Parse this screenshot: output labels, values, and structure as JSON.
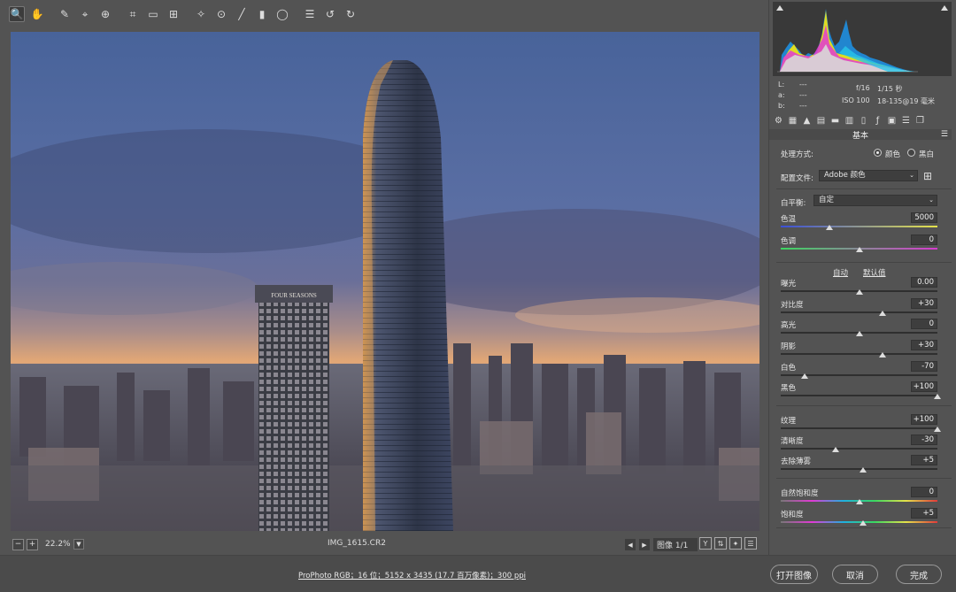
{
  "toolbar": {
    "tools": [
      {
        "name": "zoom-tool",
        "icon": "magnifier-icon",
        "glyph": "🔍",
        "active": true
      },
      {
        "name": "hand-tool",
        "icon": "hand-icon",
        "glyph": "✋"
      },
      {
        "name": "white-balance-tool",
        "icon": "eyedropper-icon",
        "glyph": "✎"
      },
      {
        "name": "color-sampler-tool",
        "icon": "color-sampler-icon",
        "glyph": "⌖"
      },
      {
        "name": "targeted-adjustment-tool",
        "icon": "target-adjust-icon",
        "glyph": "⊕"
      },
      {
        "name": "crop-tool",
        "icon": "crop-icon",
        "glyph": "⌗"
      },
      {
        "name": "straighten-tool",
        "icon": "ruler-icon",
        "glyph": "▭"
      },
      {
        "name": "transform-tool",
        "icon": "transform-icon",
        "glyph": "⊞"
      },
      {
        "name": "spot-removal-tool",
        "icon": "healing-brush-icon",
        "glyph": "✧"
      },
      {
        "name": "red-eye-tool",
        "icon": "red-eye-icon",
        "glyph": "⊙"
      },
      {
        "name": "adjustment-brush-tool",
        "icon": "brush-icon",
        "glyph": "╱"
      },
      {
        "name": "graduated-filter-tool",
        "icon": "graduated-filter-icon",
        "glyph": "▮"
      },
      {
        "name": "radial-filter-tool",
        "icon": "radial-filter-icon",
        "glyph": "◯"
      },
      {
        "name": "preferences-tool",
        "icon": "list-icon",
        "glyph": "☰"
      },
      {
        "name": "rotate-left-tool",
        "icon": "rotate-ccw-icon",
        "glyph": "↺"
      },
      {
        "name": "rotate-right-tool",
        "icon": "rotate-cw-icon",
        "glyph": "↻"
      }
    ],
    "exit_glyph": "⇥"
  },
  "status": {
    "zoom_value": "22.2%",
    "filename": "IMG_1615.CR2",
    "image_count": "图像 1/1"
  },
  "bottom": {
    "workflow_text": "ProPhoto RGB；16 位；5152 x 3435 (17.7 百万像素)；300 ppi",
    "open_button": "打开图像",
    "cancel_button": "取消",
    "done_button": "完成"
  },
  "readout": {
    "l_label": "L:",
    "a_label": "a:",
    "b_label": "b:",
    "l_value": "---",
    "a_value": "---",
    "b_value": "---",
    "aperture": "f/16",
    "shutter": "1/15 秒",
    "iso": "ISO 100",
    "lens": "18-135@19 毫米"
  },
  "panel": {
    "section_title": "基本",
    "treatment_label": "处理方式:",
    "color_option": "颜色",
    "bw_option": "黑白",
    "profile_label": "配置文件:",
    "profile_value": "Adobe 颜色",
    "wb_label": "白平衡:",
    "wb_value": "自定",
    "auto_link": "自动",
    "default_link": "默认值"
  },
  "sliders": [
    {
      "key": "temp",
      "label": "色温",
      "value": "5000",
      "pos": 0.31
    },
    {
      "key": "tint",
      "label": "色调",
      "value": "0",
      "pos": 0.5
    },
    {
      "key": "exposure",
      "label": "曝光",
      "value": "0.00",
      "pos": 0.5
    },
    {
      "key": "contrast",
      "label": "对比度",
      "value": "+30",
      "pos": 0.65
    },
    {
      "key": "highlights",
      "label": "高光",
      "value": "0",
      "pos": 0.5
    },
    {
      "key": "shadows",
      "label": "阴影",
      "value": "+30",
      "pos": 0.65
    },
    {
      "key": "whites",
      "label": "白色",
      "value": "-70",
      "pos": 0.15
    },
    {
      "key": "blacks",
      "label": "黑色",
      "value": "+100",
      "pos": 1.0
    },
    {
      "key": "texture",
      "label": "纹理",
      "value": "+100",
      "pos": 1.0
    },
    {
      "key": "clarity",
      "label": "清晰度",
      "value": "-30",
      "pos": 0.35
    },
    {
      "key": "dehaze",
      "label": "去除薄雾",
      "value": "+5",
      "pos": 0.525
    },
    {
      "key": "vibrance",
      "label": "自然饱和度",
      "value": "0",
      "pos": 0.5
    },
    {
      "key": "saturation",
      "label": "饱和度",
      "value": "+5",
      "pos": 0.525
    }
  ],
  "photo": {
    "hotel_sign": "FOUR SEASONS"
  }
}
